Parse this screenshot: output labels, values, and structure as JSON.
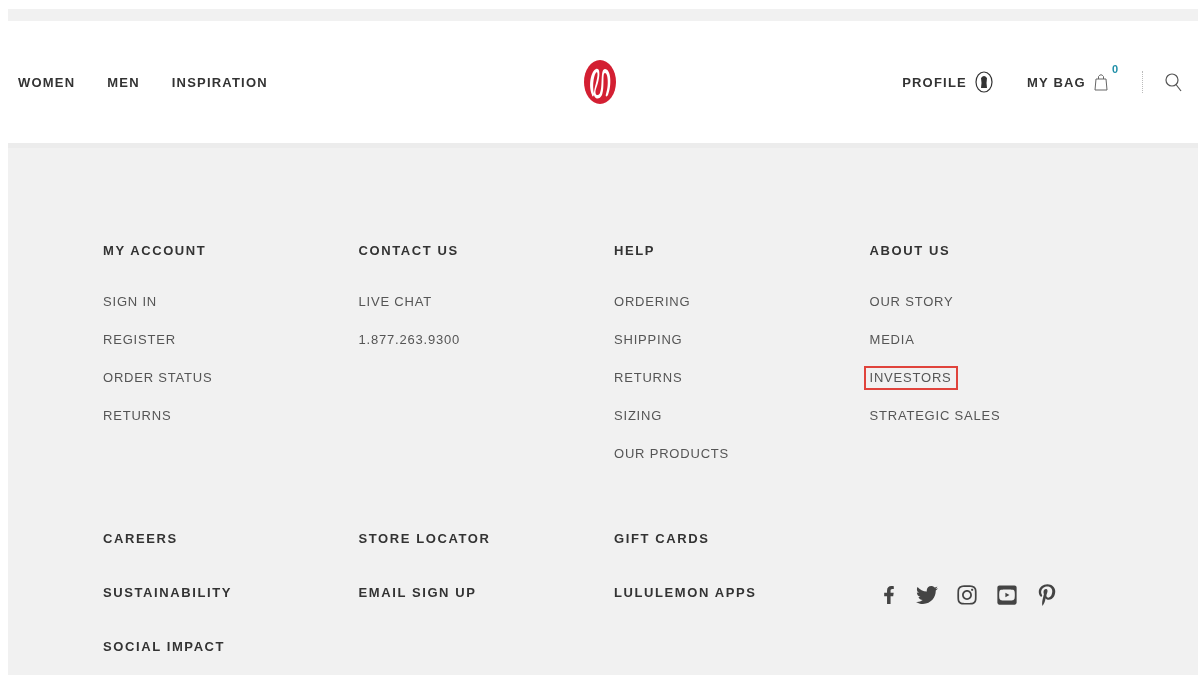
{
  "nav": {
    "links": [
      {
        "label": "WOMEN"
      },
      {
        "label": "MEN"
      },
      {
        "label": "INSPIRATION"
      }
    ],
    "profile": {
      "label": "PROFILE"
    },
    "bag": {
      "label": "MY BAG",
      "count": "0"
    }
  },
  "footer": {
    "columns": [
      {
        "heading": "MY ACCOUNT",
        "links": [
          {
            "label": "SIGN IN",
            "highlighted": false
          },
          {
            "label": "REGISTER",
            "highlighted": false
          },
          {
            "label": "ORDER STATUS",
            "highlighted": false
          },
          {
            "label": "RETURNS",
            "highlighted": false
          }
        ]
      },
      {
        "heading": "CONTACT US",
        "links": [
          {
            "label": "LIVE CHAT",
            "highlighted": false
          },
          {
            "label": "1.877.263.9300",
            "highlighted": false
          }
        ]
      },
      {
        "heading": "HELP",
        "links": [
          {
            "label": "ORDERING",
            "highlighted": false
          },
          {
            "label": "SHIPPING",
            "highlighted": false
          },
          {
            "label": "RETURNS",
            "highlighted": false
          },
          {
            "label": "SIZING",
            "highlighted": false
          },
          {
            "label": "OUR PRODUCTS",
            "highlighted": false
          }
        ]
      },
      {
        "heading": "ABOUT US",
        "links": [
          {
            "label": "OUR STORY",
            "highlighted": false
          },
          {
            "label": "MEDIA",
            "highlighted": false
          },
          {
            "label": "INVESTORS",
            "highlighted": true
          },
          {
            "label": "STRATEGIC SALES",
            "highlighted": false
          }
        ]
      }
    ],
    "bottom_columns": [
      {
        "links": [
          {
            "label": "CAREERS"
          },
          {
            "label": "SUSTAINABILITY"
          },
          {
            "label": "SOCIAL IMPACT"
          }
        ]
      },
      {
        "links": [
          {
            "label": "STORE LOCATOR"
          },
          {
            "label": "EMAIL SIGN UP"
          }
        ]
      },
      {
        "links": [
          {
            "label": "GIFT CARDS"
          },
          {
            "label": "LULULEMON APPS"
          }
        ]
      }
    ],
    "social": [
      {
        "kind": "facebook"
      },
      {
        "kind": "twitter"
      },
      {
        "kind": "instagram"
      },
      {
        "kind": "youtube"
      },
      {
        "kind": "pinterest"
      }
    ]
  }
}
